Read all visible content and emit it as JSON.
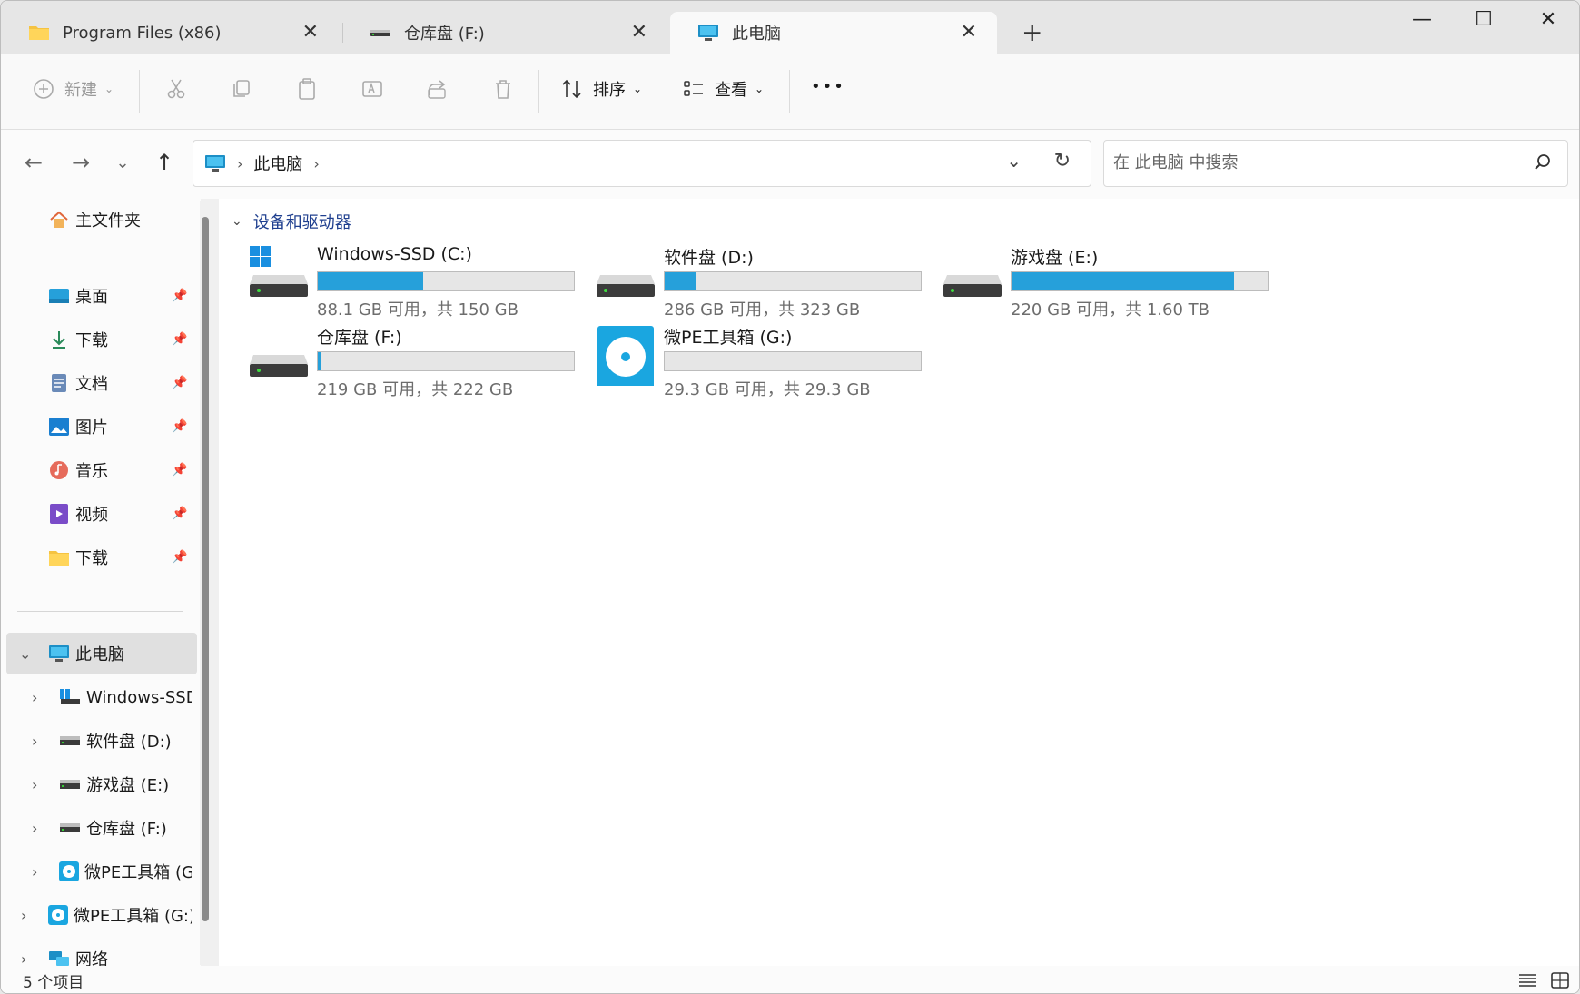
{
  "tabs": [
    {
      "label": "Program Files (x86)",
      "icon": "folder-icon"
    },
    {
      "label": "仓库盘 (F:)",
      "icon": "drive-icon"
    },
    {
      "label": "此电脑",
      "icon": "computer-icon"
    }
  ],
  "window_controls": {
    "minimize": "—",
    "maximize": "☐",
    "close": "✕",
    "new_tab": "+"
  },
  "toolbar": {
    "new_label": "新建",
    "sort_label": "排序",
    "view_label": "查看",
    "more_label": "•••"
  },
  "address": {
    "crumbs": [
      "此电脑"
    ],
    "separator": "›"
  },
  "search": {
    "placeholder": "在 此电脑 中搜索"
  },
  "sidebar": {
    "home": "主文件夹",
    "quick_access": [
      {
        "label": "桌面",
        "icon": "desktop-icon"
      },
      {
        "label": "下载",
        "icon": "download-icon"
      },
      {
        "label": "文档",
        "icon": "documents-icon"
      },
      {
        "label": "图片",
        "icon": "pictures-icon"
      },
      {
        "label": "音乐",
        "icon": "music-icon"
      },
      {
        "label": "视频",
        "icon": "videos-icon"
      },
      {
        "label": "下载",
        "icon": "folder-icon"
      }
    ],
    "this_pc": "此电脑",
    "drives": [
      {
        "label": "Windows-SSD (C:)"
      },
      {
        "label": "软件盘 (D:)"
      },
      {
        "label": "游戏盘 (E:)"
      },
      {
        "label": "仓库盘 (F:)"
      },
      {
        "label": "微PE工具箱 (G:)"
      }
    ],
    "pe_root": "微PE工具箱 (G:)",
    "network": "网络"
  },
  "main": {
    "group_title": "设备和驱动器",
    "drives": [
      {
        "name": "Windows-SSD (C:)",
        "free": "88.1 GB 可用，共 150 GB",
        "used_fraction": 0.41,
        "icon": "windows-drive-icon"
      },
      {
        "name": "软件盘 (D:)",
        "free": "286 GB 可用，共 323 GB",
        "used_fraction": 0.12,
        "icon": "hdd-icon"
      },
      {
        "name": "游戏盘 (E:)",
        "free": "220 GB 可用，共 1.60 TB",
        "used_fraction": 0.87,
        "icon": "hdd-icon"
      },
      {
        "name": "仓库盘 (F:)",
        "free": "219 GB 可用，共 222 GB",
        "used_fraction": 0.01,
        "icon": "hdd-icon"
      },
      {
        "name": "微PE工具箱 (G:)",
        "free": "29.3 GB 可用，共 29.3 GB",
        "used_fraction": 0.0,
        "icon": "disc-drive-icon"
      }
    ]
  },
  "status": {
    "count": "5 个项目"
  },
  "colors": {
    "accent": "#26a0da",
    "link": "#1f3f8f"
  }
}
